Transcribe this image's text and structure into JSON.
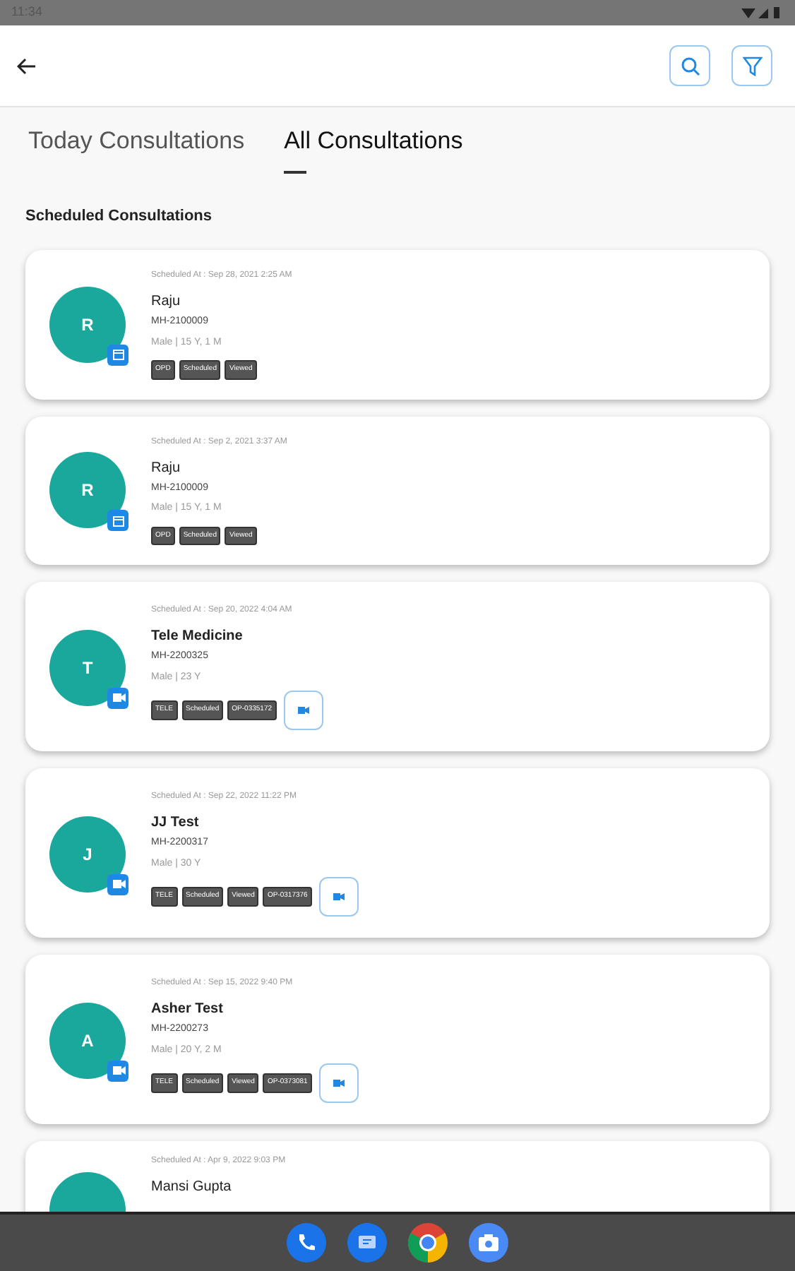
{
  "status_bar": {
    "time": "11:34"
  },
  "tabs": [
    {
      "label": "Today Consultations",
      "selected": false
    },
    {
      "label": "All Consultations",
      "selected": true
    }
  ],
  "section_title": "Scheduled Consultations",
  "consultations": [
    {
      "kind": "opd",
      "initial": "R",
      "scheduled": "Scheduled At : Sep 28, 2021 2:25 AM",
      "name": "Raju",
      "id": "MH-2100009",
      "info": "Male | 15 Y, 1 M",
      "tags": [
        "OPD",
        "Scheduled",
        "Viewed"
      ]
    },
    {
      "kind": "opd",
      "initial": "R",
      "scheduled": "Scheduled At : Sep 2, 2021 3:37 AM",
      "name": "Raju",
      "id": "MH-2100009",
      "info": "Male | 15 Y, 1 M",
      "tags": [
        "OPD",
        "Scheduled",
        "Viewed"
      ]
    },
    {
      "kind": "tele",
      "initial": "T",
      "scheduled": "Scheduled At : Sep 20, 2022 4:04 AM",
      "name": "Tele Medicine",
      "id": "MH-2200325",
      "info": "Male | 23 Y",
      "tags": [
        "TELE",
        "Scheduled",
        "OP-0335172"
      ]
    },
    {
      "kind": "tele",
      "initial": "J",
      "scheduled": "Scheduled At : Sep 22, 2022 11:22 PM",
      "name": "JJ Test",
      "id": "MH-2200317",
      "info": "Male | 30 Y",
      "tags": [
        "TELE",
        "Scheduled",
        "Viewed",
        "OP-0317376"
      ]
    },
    {
      "kind": "tele",
      "initial": "A",
      "scheduled": "Scheduled At : Sep 15, 2022 9:40 PM",
      "name": "Asher Test",
      "id": "MH-2200273",
      "info": "Male | 20 Y, 2 M",
      "tags": [
        "TELE",
        "Scheduled",
        "Viewed",
        "OP-0373081"
      ]
    },
    {
      "kind": "partial",
      "scheduled": "Scheduled At : Apr 9, 2022 9:03 PM",
      "name": "Mansi Gupta"
    }
  ]
}
